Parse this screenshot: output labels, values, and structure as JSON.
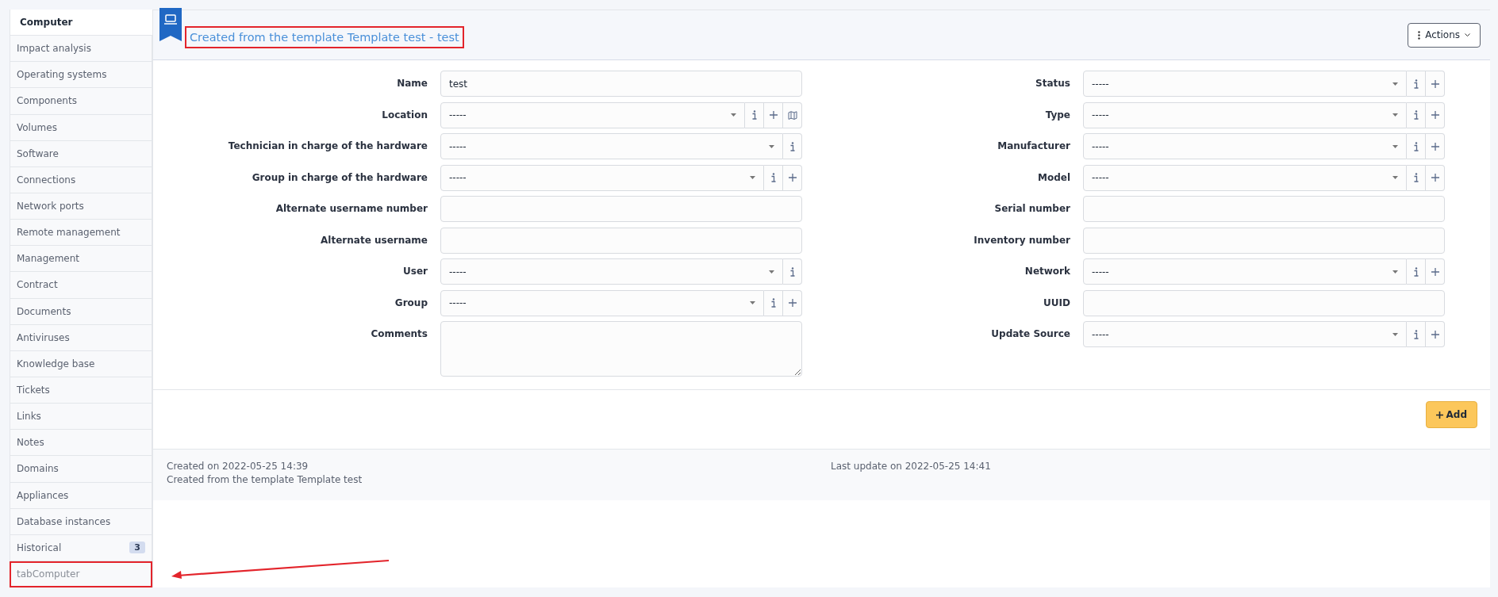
{
  "sidebar": {
    "items": [
      {
        "label": "Computer",
        "selected": true,
        "highlighted": false
      },
      {
        "label": "Impact analysis",
        "selected": false,
        "highlighted": false
      },
      {
        "label": "Operating systems",
        "selected": false,
        "highlighted": false
      },
      {
        "label": "Components",
        "selected": false,
        "highlighted": false
      },
      {
        "label": "Volumes",
        "selected": false,
        "highlighted": false
      },
      {
        "label": "Software",
        "selected": false,
        "highlighted": false
      },
      {
        "label": "Connections",
        "selected": false,
        "highlighted": false
      },
      {
        "label": "Network ports",
        "selected": false,
        "highlighted": false
      },
      {
        "label": "Remote management",
        "selected": false,
        "highlighted": false
      },
      {
        "label": "Management",
        "selected": false,
        "highlighted": false
      },
      {
        "label": "Contract",
        "selected": false,
        "highlighted": false
      },
      {
        "label": "Documents",
        "selected": false,
        "highlighted": false
      },
      {
        "label": "Antiviruses",
        "selected": false,
        "highlighted": false
      },
      {
        "label": "Knowledge base",
        "selected": false,
        "highlighted": false
      },
      {
        "label": "Tickets",
        "selected": false,
        "highlighted": false
      },
      {
        "label": "Links",
        "selected": false,
        "highlighted": false
      },
      {
        "label": "Notes",
        "selected": false,
        "highlighted": false
      },
      {
        "label": "Domains",
        "selected": false,
        "highlighted": false
      },
      {
        "label": "Appliances",
        "selected": false,
        "highlighted": false
      },
      {
        "label": "Database instances",
        "selected": false,
        "highlighted": false
      },
      {
        "label": "Historical",
        "selected": false,
        "highlighted": false,
        "badge": "3"
      },
      {
        "label": "tabComputer",
        "selected": false,
        "highlighted": true
      }
    ]
  },
  "header": {
    "title": "Created from the template Template test - test",
    "title_highlighted": true,
    "actions_button": "Actions"
  },
  "form": {
    "left": [
      {
        "kind": "text",
        "label": "Name",
        "value": "test"
      },
      {
        "kind": "select",
        "label": "Location",
        "value": "-----",
        "buttons": [
          {
            "kind": "info"
          },
          {
            "kind": "add"
          },
          {
            "kind": "map"
          }
        ]
      },
      {
        "kind": "select",
        "label": "Technician in charge of the hardware",
        "value": "-----",
        "buttons": [
          {
            "kind": "info"
          }
        ]
      },
      {
        "kind": "select",
        "label": "Group in charge of the hardware",
        "value": "-----",
        "buttons": [
          {
            "kind": "info"
          },
          {
            "kind": "add"
          }
        ]
      },
      {
        "kind": "text",
        "label": "Alternate username number"
      },
      {
        "kind": "text",
        "label": "Alternate username"
      },
      {
        "kind": "select",
        "label": "User",
        "value": "-----",
        "buttons": [
          {
            "kind": "info"
          }
        ]
      },
      {
        "kind": "select",
        "label": "Group",
        "value": "-----",
        "buttons": [
          {
            "kind": "info"
          },
          {
            "kind": "add"
          }
        ]
      },
      {
        "kind": "textarea",
        "label": "Comments"
      }
    ],
    "right": [
      {
        "kind": "select",
        "label": "Status",
        "value": "-----",
        "buttons": [
          {
            "kind": "info"
          },
          {
            "kind": "add"
          }
        ]
      },
      {
        "kind": "select",
        "label": "Type",
        "value": "-----",
        "buttons": [
          {
            "kind": "info"
          },
          {
            "kind": "add"
          }
        ]
      },
      {
        "kind": "select",
        "label": "Manufacturer",
        "value": "-----",
        "buttons": [
          {
            "kind": "info"
          },
          {
            "kind": "add"
          }
        ]
      },
      {
        "kind": "select",
        "label": "Model",
        "value": "-----",
        "buttons": [
          {
            "kind": "info"
          },
          {
            "kind": "add"
          }
        ]
      },
      {
        "kind": "text",
        "label": "Serial number"
      },
      {
        "kind": "text",
        "label": "Inventory number"
      },
      {
        "kind": "select",
        "label": "Network",
        "value": "-----",
        "buttons": [
          {
            "kind": "info"
          },
          {
            "kind": "add"
          }
        ]
      },
      {
        "kind": "text",
        "label": "UUID"
      },
      {
        "kind": "select",
        "label": "Update Source",
        "value": "-----",
        "buttons": [
          {
            "kind": "info"
          },
          {
            "kind": "add"
          }
        ]
      }
    ]
  },
  "add_button": "Add",
  "footer": {
    "created": "Created on 2022-05-25 14:39",
    "template": "Created from the template Template test",
    "last_update": "Last update on 2022-05-25 14:41"
  }
}
